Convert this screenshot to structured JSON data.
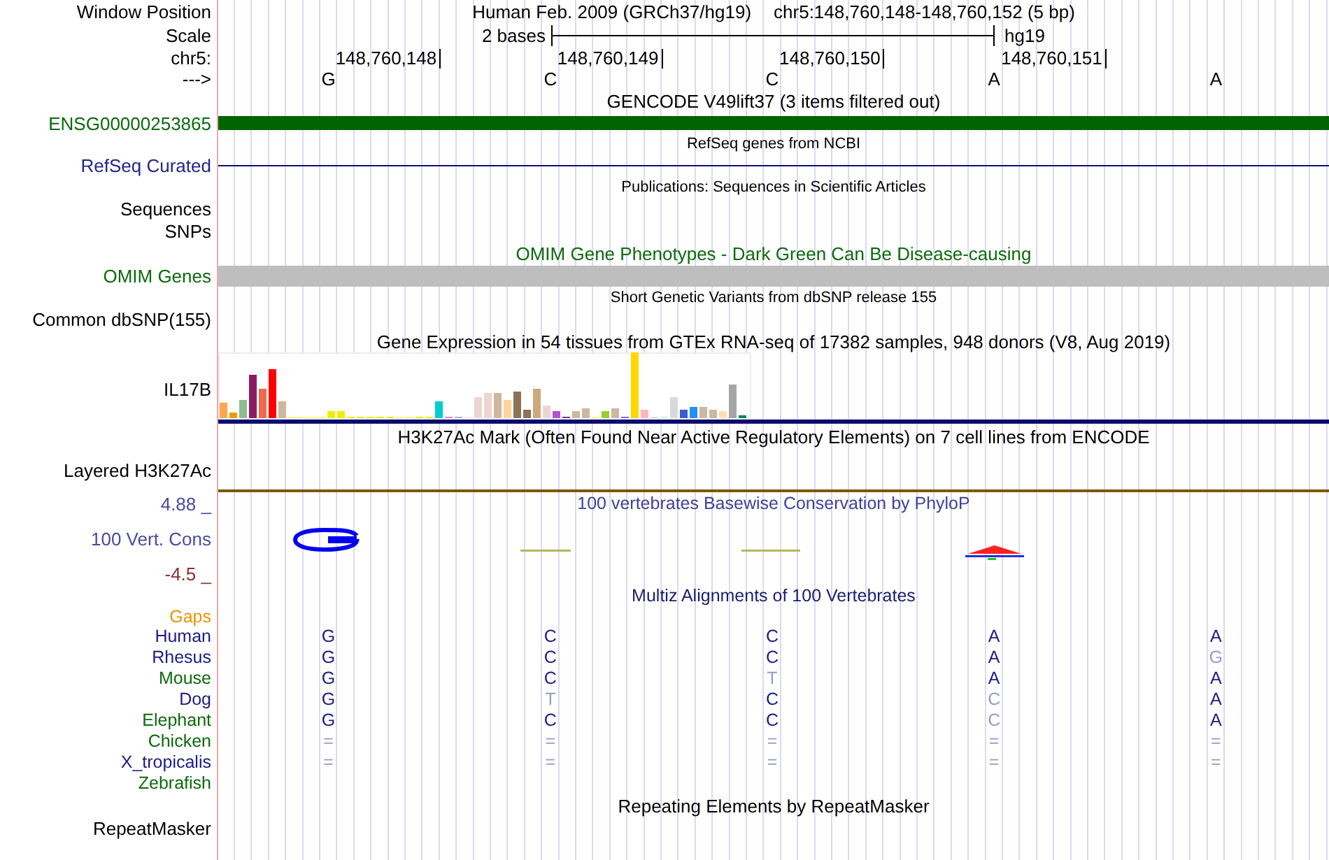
{
  "header": {
    "position_label": "Window Position",
    "assembly": "Human Feb. 2009 (GRCh37/hg19)",
    "range": "chr5:148,760,148-148,760,152 (5 bp)",
    "scale_label": "Scale",
    "scale_span": "2 bases",
    "scale_db": "hg19",
    "ruler_label": "chr5:",
    "ruler_ticks": [
      "148,760,148",
      "148,760,149",
      "148,760,150",
      "148,760,151"
    ],
    "strand_label": "--->",
    "bases": [
      "G",
      "C",
      "C",
      "A",
      "A"
    ]
  },
  "tracks": [
    {
      "kind": "gene",
      "title": "GENCODE V49lift37 (3 items filtered out)",
      "labels": [
        "ENSG00000253865"
      ],
      "color": "#0b6a0b"
    },
    {
      "kind": "refseq",
      "title": "RefSeq genes from NCBI",
      "labels": [
        "RefSeq Curated"
      ],
      "color": "#24248c"
    },
    {
      "kind": "publications",
      "title": "Publications: Sequences in Scientific Articles",
      "labels": [
        "Sequences",
        "SNPs"
      ],
      "color": "#000000"
    },
    {
      "kind": "omim",
      "title": "OMIM Gene Phenotypes - Dark Green Can Be Disease-causing",
      "labels": [
        "OMIM Genes"
      ],
      "color": "#0b6a0b"
    },
    {
      "kind": "variants",
      "title": "Short Genetic Variants from dbSNP release 155",
      "labels": [
        "Common dbSNP(155)"
      ],
      "color": "#000000"
    },
    {
      "kind": "expression",
      "title": "Gene Expression in 54 tissues from GTEx RNA-seq of 17382 samples, 948 donors (V8, Aug 2019)",
      "labels": [
        "IL17B"
      ],
      "color": "#000000"
    },
    {
      "kind": "signal",
      "title": "H3K27Ac Mark (Often Found Near Active Regulatory Elements) on 7 cell lines from ENCODE",
      "labels": [
        "Layered H3K27Ac"
      ],
      "color": "#000000"
    },
    {
      "kind": "conservation",
      "title": "100 vertebrates Basewise Conservation by PhyloP",
      "labels": [
        "100 Vert. Cons"
      ],
      "color": "#4a4aa2",
      "max_label": "4.88 _",
      "min_label": "-4.5 _"
    },
    {
      "kind": "alignment",
      "title": "Multiz Alignments of 100 Vertebrates",
      "gaps_label": "Gaps",
      "species": [
        {
          "name": "Human",
          "color": "#1c1c84",
          "bases": [
            {
              "base": "G",
              "mismatch": false
            },
            {
              "base": "C",
              "mismatch": false
            },
            {
              "base": "C",
              "mismatch": false
            },
            {
              "base": "A",
              "mismatch": false
            },
            {
              "base": "A",
              "mismatch": false
            }
          ]
        },
        {
          "name": "Rhesus",
          "color": "#1c1c84",
          "bases": [
            {
              "base": "G",
              "mismatch": false
            },
            {
              "base": "C",
              "mismatch": false
            },
            {
              "base": "C",
              "mismatch": false
            },
            {
              "base": "A",
              "mismatch": false
            },
            {
              "base": "G",
              "mismatch": true
            }
          ]
        },
        {
          "name": "Mouse",
          "color": "#0b6a0b",
          "bases": [
            {
              "base": "G",
              "mismatch": false
            },
            {
              "base": "C",
              "mismatch": false
            },
            {
              "base": "T",
              "mismatch": true
            },
            {
              "base": "A",
              "mismatch": false
            },
            {
              "base": "A",
              "mismatch": false
            }
          ]
        },
        {
          "name": "Dog",
          "color": "#1c1c84",
          "bases": [
            {
              "base": "G",
              "mismatch": false
            },
            {
              "base": "T",
              "mismatch": true
            },
            {
              "base": "C",
              "mismatch": false
            },
            {
              "base": "C",
              "mismatch": true
            },
            {
              "base": "A",
              "mismatch": false
            }
          ]
        },
        {
          "name": "Elephant",
          "color": "#0b6a0b",
          "bases": [
            {
              "base": "G",
              "mismatch": false
            },
            {
              "base": "C",
              "mismatch": false
            },
            {
              "base": "C",
              "mismatch": false
            },
            {
              "base": "C",
              "mismatch": true
            },
            {
              "base": "A",
              "mismatch": false
            }
          ]
        },
        {
          "name": "Chicken",
          "color": "#0b6a0b",
          "bases": [
            {
              "base": "=",
              "mismatch": true
            },
            {
              "base": "=",
              "mismatch": true
            },
            {
              "base": "=",
              "mismatch": true
            },
            {
              "base": "=",
              "mismatch": true
            },
            {
              "base": "=",
              "mismatch": true
            }
          ]
        },
        {
          "name": "X_tropicalis",
          "color": "#1c1c84",
          "bases": [
            {
              "base": "=",
              "mismatch": true
            },
            {
              "base": "=",
              "mismatch": true
            },
            {
              "base": "=",
              "mismatch": true
            },
            {
              "base": "=",
              "mismatch": true
            },
            {
              "base": "=",
              "mismatch": true
            }
          ]
        },
        {
          "name": "Zebrafish",
          "color": "#0b6a0b"
        }
      ]
    },
    {
      "kind": "repeats",
      "title": "Repeating Elements by RepeatMasker",
      "labels": [
        "RepeatMasker"
      ],
      "color": "#000000"
    }
  ]
}
